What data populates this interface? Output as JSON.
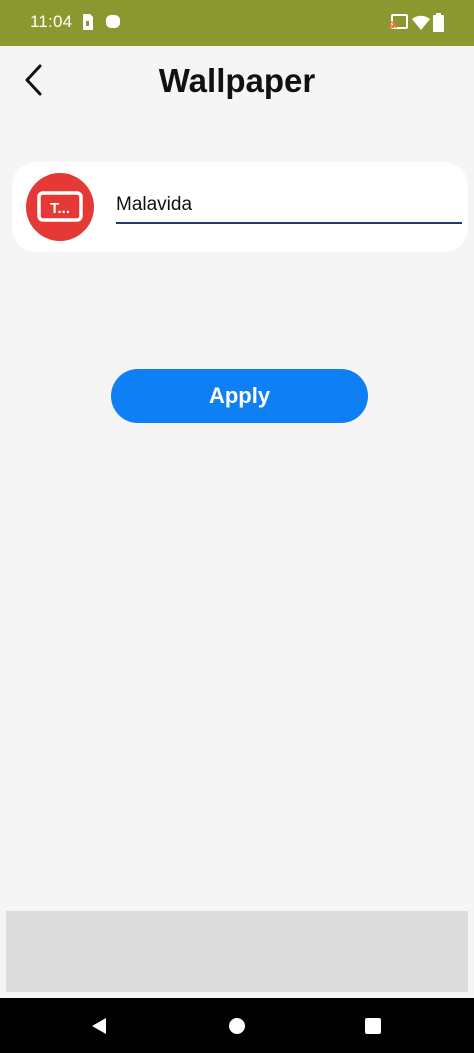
{
  "status_bar": {
    "time": "11:04",
    "background_color": "#8a982f",
    "icons": [
      "sim-card-icon",
      "notification-dot-icon",
      "cast-icon",
      "wifi-icon",
      "battery-icon"
    ]
  },
  "header": {
    "title": "Wallpaper",
    "back_icon": "chevron-left-icon"
  },
  "app_row": {
    "icon": "text-message-app-icon",
    "icon_color": "#e53935",
    "icon_text": "T...",
    "name_value": "Malavida"
  },
  "apply_button": {
    "label": "Apply",
    "color": "#0f7ff5"
  },
  "nav_bar": {
    "buttons": [
      "back-triangle-icon",
      "home-circle-icon",
      "recents-square-icon"
    ]
  }
}
